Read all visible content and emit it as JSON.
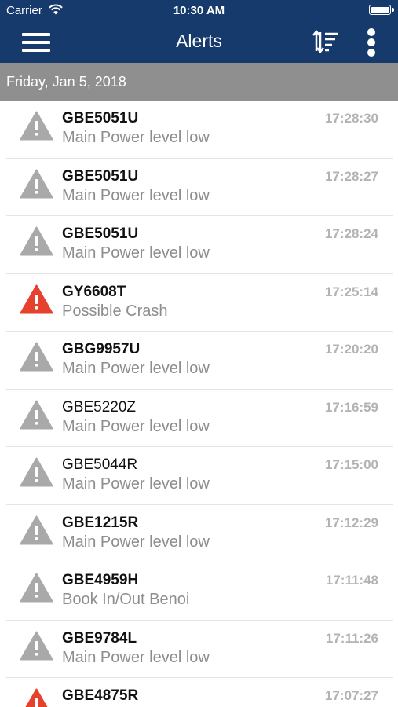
{
  "status_bar": {
    "carrier": "Carrier",
    "time": "10:30 AM"
  },
  "header": {
    "title": "Alerts"
  },
  "date_header": "Friday, Jan 5, 2018",
  "colors": {
    "header_bg": "#163a6c",
    "warning_grey": "#a9a9a9",
    "warning_red": "#e5412d"
  },
  "alerts": [
    {
      "plate": "GBE5051U",
      "message": "Main Power level low",
      "time": "17:28:30",
      "severity": "grey",
      "bold": true
    },
    {
      "plate": "GBE5051U",
      "message": "Main Power level low",
      "time": "17:28:27",
      "severity": "grey",
      "bold": true
    },
    {
      "plate": "GBE5051U",
      "message": "Main Power level low",
      "time": "17:28:24",
      "severity": "grey",
      "bold": true
    },
    {
      "plate": "GY6608T",
      "message": "Possible Crash",
      "time": "17:25:14",
      "severity": "red",
      "bold": true
    },
    {
      "plate": "GBG9957U",
      "message": "Main Power level low",
      "time": "17:20:20",
      "severity": "grey",
      "bold": true
    },
    {
      "plate": "GBE5220Z",
      "message": "Main Power level low",
      "time": "17:16:59",
      "severity": "grey",
      "bold": false
    },
    {
      "plate": "GBE5044R",
      "message": "Main Power level low",
      "time": "17:15:00",
      "severity": "grey",
      "bold": false
    },
    {
      "plate": "GBE1215R",
      "message": "Main Power level low",
      "time": "17:12:29",
      "severity": "grey",
      "bold": true
    },
    {
      "plate": "GBE4959H",
      "message": "Book In/Out Benoi",
      "time": "17:11:48",
      "severity": "grey",
      "bold": true
    },
    {
      "plate": "GBE9784L",
      "message": "Main Power level low",
      "time": "17:11:26",
      "severity": "grey",
      "bold": true
    },
    {
      "plate": "GBE4875R",
      "message": "",
      "time": "17:07:27",
      "severity": "red",
      "bold": true
    }
  ]
}
